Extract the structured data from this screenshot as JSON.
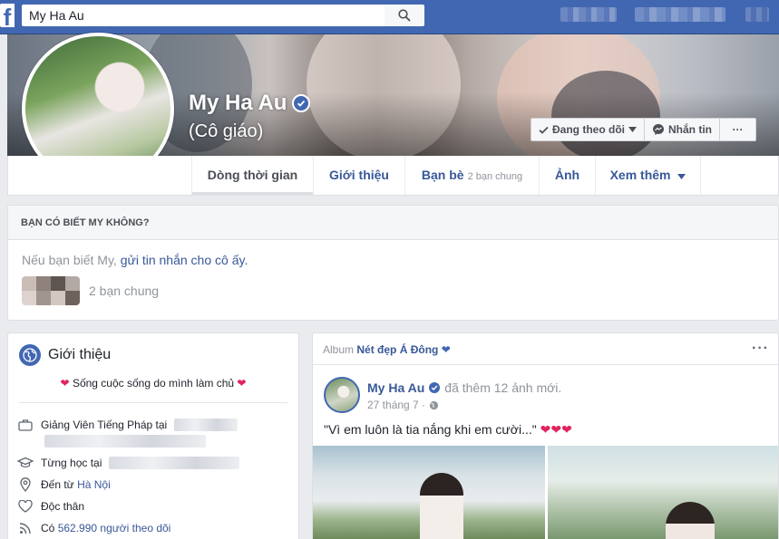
{
  "search": {
    "value": "My Ha Au"
  },
  "profile": {
    "name": "My Ha Au",
    "subtitle": "(Cô giáo)"
  },
  "cover_actions": {
    "following_label": "Đang theo dõi",
    "message_label": "Nhắn tin",
    "more_label": "···"
  },
  "tabs": [
    {
      "label": "Dòng thời gian"
    },
    {
      "label": "Giới thiệu"
    },
    {
      "label": "Bạn bè",
      "meta": "2 bạn chung"
    },
    {
      "label": "Ảnh"
    },
    {
      "label": "Xem thêm"
    }
  ],
  "know_card": {
    "heading": "BẠN CÓ BIẾT MY KHÔNG?",
    "text_prefix": "Nếu bạn biết My, ",
    "link_text": "gửi tin nhắn cho cô ấy.",
    "mutual_text": "2 bạn chung"
  },
  "intro": {
    "title": "Giới thiệu",
    "bio": "Sống cuộc sống do mình làm chủ",
    "rows": [
      {
        "icon": "briefcase-icon",
        "text": "Giảng Viên Tiếng Pháp tại"
      },
      {
        "icon": "graduation-cap-icon",
        "text": "Từng học tại"
      },
      {
        "icon": "location-pin-icon",
        "prefix": "Đến từ ",
        "link": "Hà Nội"
      },
      {
        "icon": "heart-outline-icon",
        "text": "Độc thân"
      },
      {
        "icon": "rss-icon",
        "prefix": "Có ",
        "link": "562.990 người theo dõi"
      }
    ]
  },
  "post": {
    "album_prefix": "Album ",
    "album_name": "Nét đẹp Á Đông",
    "author": "My Ha Au",
    "action": "đã thêm 12 ảnh mới.",
    "time": "27 tháng 7 ·",
    "text": "\"Vì em luôn là tia nắng khi em cười...\"",
    "hearts": "❤❤❤"
  },
  "colors": {
    "brand": "#4267b2",
    "link": "#385898",
    "background": "#e9ebee",
    "heart": "#e0245e"
  }
}
